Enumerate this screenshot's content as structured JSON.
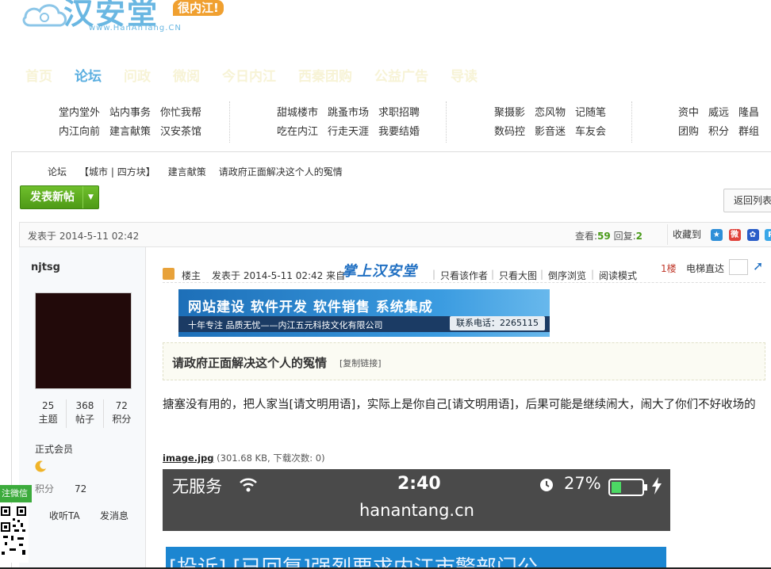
{
  "logo": {
    "name": "汉安堂",
    "slogan": "很内江!",
    "url": "www.HanAnTang.CN"
  },
  "main_nav": [
    "首页",
    "论坛",
    "问政",
    "微阅",
    "今日内江",
    "西秦团购",
    "公益广告",
    "导读"
  ],
  "main_nav_active": 1,
  "forum_dir": [
    {
      "row1": [
        "堂内堂外",
        "站内事务",
        "你忙我帮"
      ],
      "row2": [
        "内江向前",
        "建言献策",
        "汉安茶馆"
      ]
    },
    {
      "row1": [
        "甜城楼市",
        "跳蚤市场",
        "求职招聘"
      ],
      "row2": [
        "吃在内江",
        "行走天涯",
        "我要结婚"
      ]
    },
    {
      "row1": [
        "聚摄影",
        "恋风物",
        "记随笔"
      ],
      "row2": [
        "数码控",
        "影音迷",
        "车友会"
      ]
    },
    {
      "row1": [
        "资中",
        "威远",
        "隆昌"
      ],
      "row2": [
        "团购",
        "积分",
        "群组"
      ]
    }
  ],
  "breadcrumb": [
    "论坛",
    "【城市 | 四方块】",
    "建言献策",
    "请政府正面解决这个人的冤情"
  ],
  "buttons": {
    "new_post": "发表新帖",
    "back_to_list": "返回列表"
  },
  "thread": {
    "posted": "发表于 2014-5-11 02:42",
    "views_label": "查看:",
    "views": "59",
    "replies_label": " 回复:",
    "replies": "2",
    "favorite": "收藏到"
  },
  "author": {
    "name": "njtsg",
    "stats": [
      {
        "value": "25",
        "label": "主题"
      },
      {
        "value": "368",
        "label": "帖子"
      },
      {
        "value": "72",
        "label": "积分"
      }
    ],
    "rank": "正式会员",
    "points_label": "积分",
    "points": "72",
    "follow": "收听TA",
    "message": "发消息"
  },
  "post": {
    "op_label": "楼主",
    "time": "发表于 2014-5-11 02:42 来自",
    "source_brand": "掌上汉安堂",
    "links": [
      "只看该作者",
      "只看大图",
      "倒序浏览",
      "阅读模式"
    ],
    "floor": "1楼",
    "jump_label": "电梯直达",
    "title": "请政府正面解决这个人的冤情",
    "copy_link": "[复制链接]",
    "body": "搪塞没有用的，把人家当[请文明用语]，实际上是你自己[请文明用语]，后果可能是继续闹大，闹大了你们不好收场的",
    "attachment_name": "image.jpg",
    "attachment_info": " (301.68 KB, 下载次数: 0)"
  },
  "ad": {
    "title": "网站建设 软件开发 软件销售 系统集成",
    "tagline": "十年专注  品质无忧——内江五元科技文化有限公司",
    "phone": "联系电话：2265115"
  },
  "phone_screenshot": {
    "carrier": "无服务",
    "time": "2:40",
    "battery": "27%",
    "url": "hanantang.cn"
  },
  "second_image_text": "[投诉] [已回复]强烈要求内江市警部门公",
  "wechat_tab": "注微信",
  "colors": {
    "accent_blue": "#5aaee0",
    "green_button": "#4e9a16",
    "floor_red": "#c0392b"
  }
}
